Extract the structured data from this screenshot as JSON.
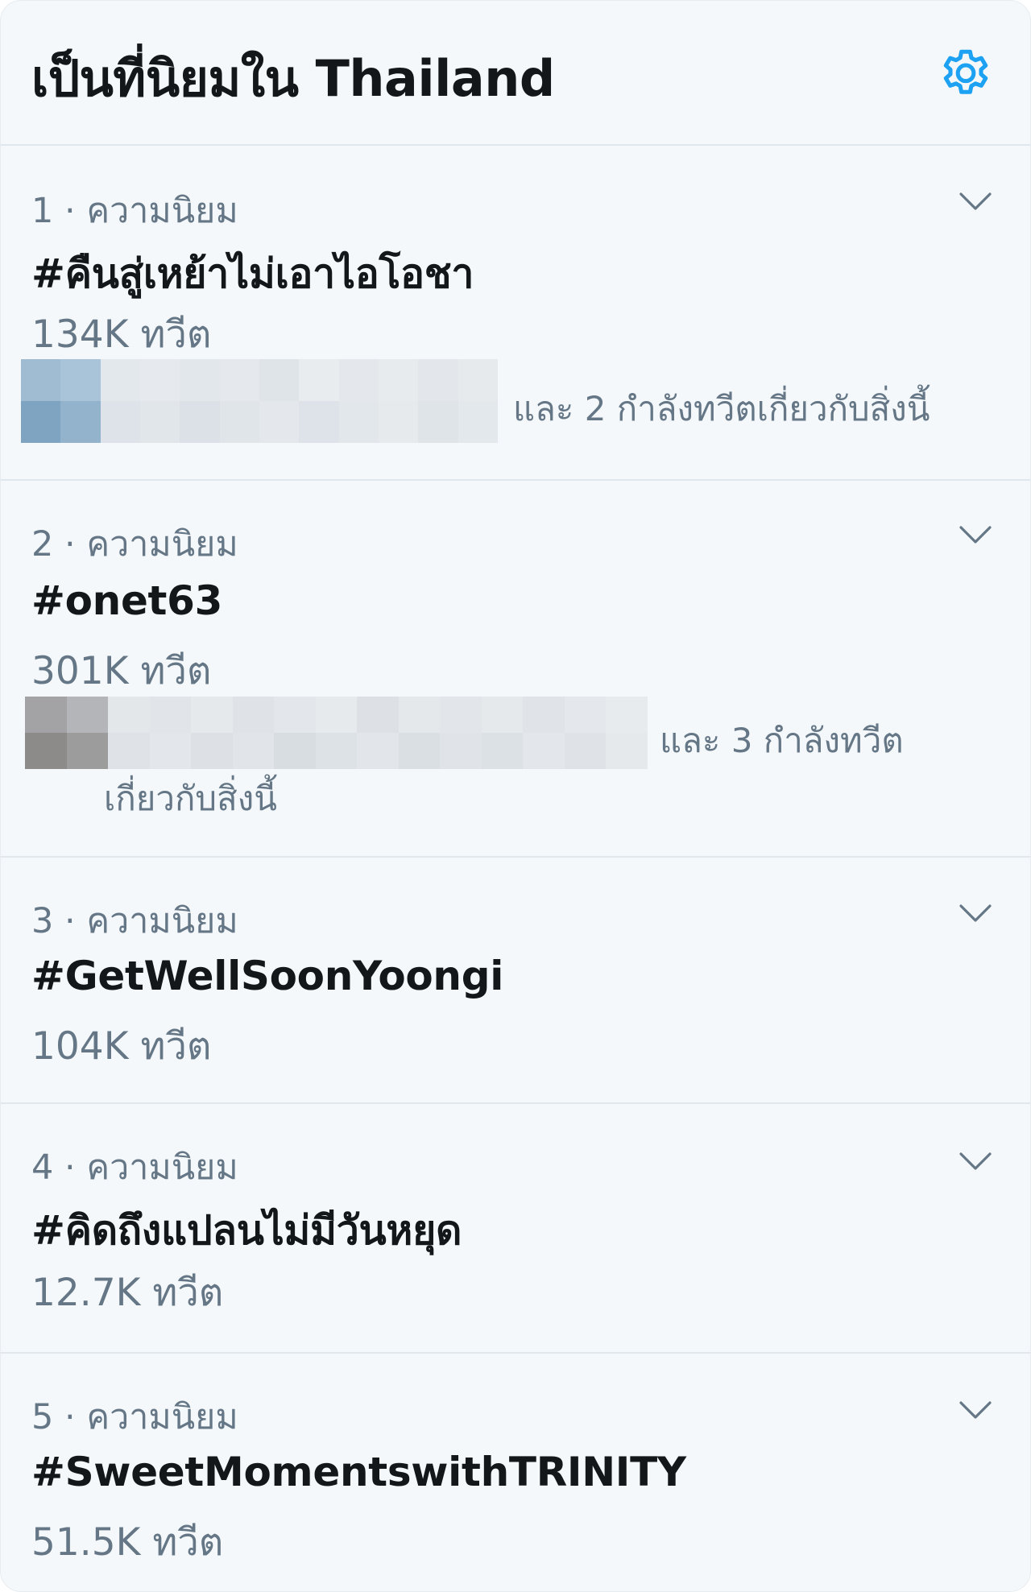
{
  "header": {
    "title": "เป็นที่นิยมใน Thailand",
    "settings_icon": "gear-icon",
    "accent_color": "#1da1f2"
  },
  "trends": [
    {
      "meta": "1 · ความนิยม",
      "hashtag": "#คืนสู่เหย้าไม่เอาไอโอชา",
      "count": "134K ทวีต",
      "context_line1": "และ 2 กำลังทวีตเกี่ยวกับสิ่งนี้",
      "context_line2": ""
    },
    {
      "meta": "2 · ความนิยม",
      "hashtag": "#onet63",
      "count": "301K ทวีต",
      "context_line1": "และ 3 กำลังทวีต",
      "context_line2": "เกี่ยวกับสิ่งนี้"
    },
    {
      "meta": "3 · ความนิยม",
      "hashtag": "#GetWellSoonYoongi",
      "count": "104K ทวีต"
    },
    {
      "meta": "4 · ความนิยม",
      "hashtag": "#คิดถึงแปลนไม่มีวันหยุด",
      "count": "12.7K ทวีต"
    },
    {
      "meta": "5 · ความนิยม",
      "hashtag": "#SweetMomentswithTRINITY",
      "count": "51.5K ทวีต"
    }
  ]
}
